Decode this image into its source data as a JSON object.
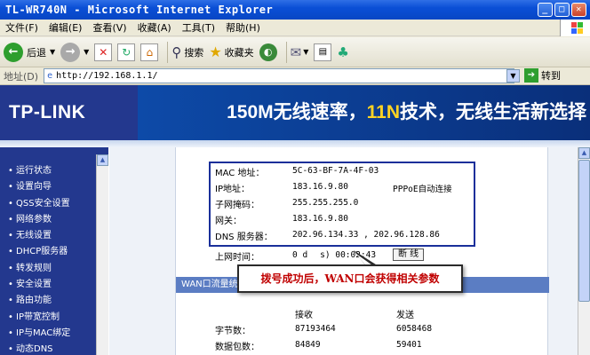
{
  "window": {
    "title": "TL-WR740N - Microsoft Internet Explorer"
  },
  "menu": [
    "文件(F)",
    "编辑(E)",
    "查看(V)",
    "收藏(A)",
    "工具(T)",
    "帮助(H)"
  ],
  "toolbar": {
    "back_label": "后退",
    "search_label": "搜索",
    "favorites_label": "收藏夹"
  },
  "address": {
    "label": "地址(D)",
    "url": "http://192.168.1.1/",
    "go_label": "转到"
  },
  "banner": {
    "logo": "TP-LINK",
    "slogan_pre": "150M无线速率，",
    "slogan_hl": "11N",
    "slogan_post": "技术，无线生活新选择"
  },
  "sidebar": [
    "运行状态",
    "设置向导",
    "QSS安全设置",
    "网络参数",
    "无线设置",
    "DHCP服务器",
    "转发规则",
    "安全设置",
    "路由功能",
    "IP带宽控制",
    "IP与MAC绑定",
    "动态DNS"
  ],
  "wan": {
    "mac_label": "MAC 地址：",
    "mac": "5C-63-BF-7A-4F-03",
    "ip_label": "IP地址：",
    "ip": "183.16.9.80",
    "ip_note": "PPPoE自动连接",
    "mask_label": "子网掩码：",
    "mask": "255.255.255.0",
    "gw_label": "网关：",
    "gw": "183.16.9.80",
    "dns_label": "DNS 服务器：",
    "dns": "202.96.134.33 , 202.96.128.86",
    "uptime_label": "上网时间：",
    "uptime_a": "0 d",
    "uptime_b": "s)",
    "uptime_c": "00:02:43",
    "disconnect_label": "断 线"
  },
  "callout": "拨号成功后，WAN口会获得相关参数",
  "traffic": {
    "title": "WAN口流量统计",
    "recv_header": "接收",
    "send_header": "发送",
    "bytes_label": "字节数：",
    "bytes_recv": "87193464",
    "bytes_send": "6058468",
    "packets_label": "数据包数：",
    "packets_recv": "84849",
    "packets_send": "59401"
  }
}
